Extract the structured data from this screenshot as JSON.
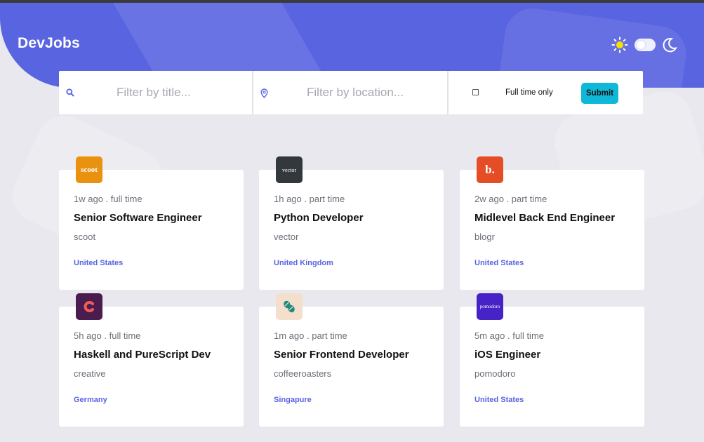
{
  "app": {
    "brand": "DevJobs"
  },
  "colors": {
    "accent": "#5964e0",
    "submit": "#0fb8d6",
    "background": "#e8e8ee"
  },
  "theme": {
    "light_icon": "sun-icon",
    "dark_icon": "moon-icon",
    "dark_mode": false
  },
  "search": {
    "title_placeholder": "Filter by title...",
    "location_placeholder": "Filter by location...",
    "fulltime_label": "Full time only",
    "fulltime_checked": false,
    "submit_label": "Submit"
  },
  "jobs": [
    {
      "logo_text": "scoot",
      "logo_bg": "#e99210",
      "logo_icon": "scoot-logo",
      "posted": "1w ago",
      "contract": "full time",
      "title": "Senior Software Engineer",
      "company": "scoot",
      "location": "United States"
    },
    {
      "logo_text": "vector",
      "logo_bg": "#33383d",
      "logo_icon": "vector-logo",
      "posted": "1h ago",
      "contract": "part time",
      "title": "Python Developer",
      "company": "vector",
      "location": "United Kingdom"
    },
    {
      "logo_text": "b.",
      "logo_bg": "#e54d26",
      "logo_icon": "blogr-logo",
      "posted": "2w ago",
      "contract": "part time",
      "title": "Midlevel Back End Engineer",
      "company": "blogr",
      "location": "United States"
    },
    {
      "logo_text": "",
      "logo_bg": "#4b1d4f",
      "logo_icon": "creative-logo",
      "posted": "5h ago",
      "contract": "full time",
      "title": "Haskell and PureScript Dev",
      "company": "creative",
      "location": "Germany"
    },
    {
      "logo_text": "",
      "logo_bg": "#f4dfcd",
      "logo_icon": "coffeeroasters-logo",
      "posted": "1m ago",
      "contract": "part time",
      "title": "Senior Frontend Developer",
      "company": "coffeeroasters",
      "location": "Singapure"
    },
    {
      "logo_text": "pomodoro",
      "logo_bg": "#4722c6",
      "logo_icon": "pomodoro-logo",
      "posted": "5m ago",
      "contract": "full time",
      "title": "iOS Engineer",
      "company": "pomodoro",
      "location": "United States"
    }
  ]
}
